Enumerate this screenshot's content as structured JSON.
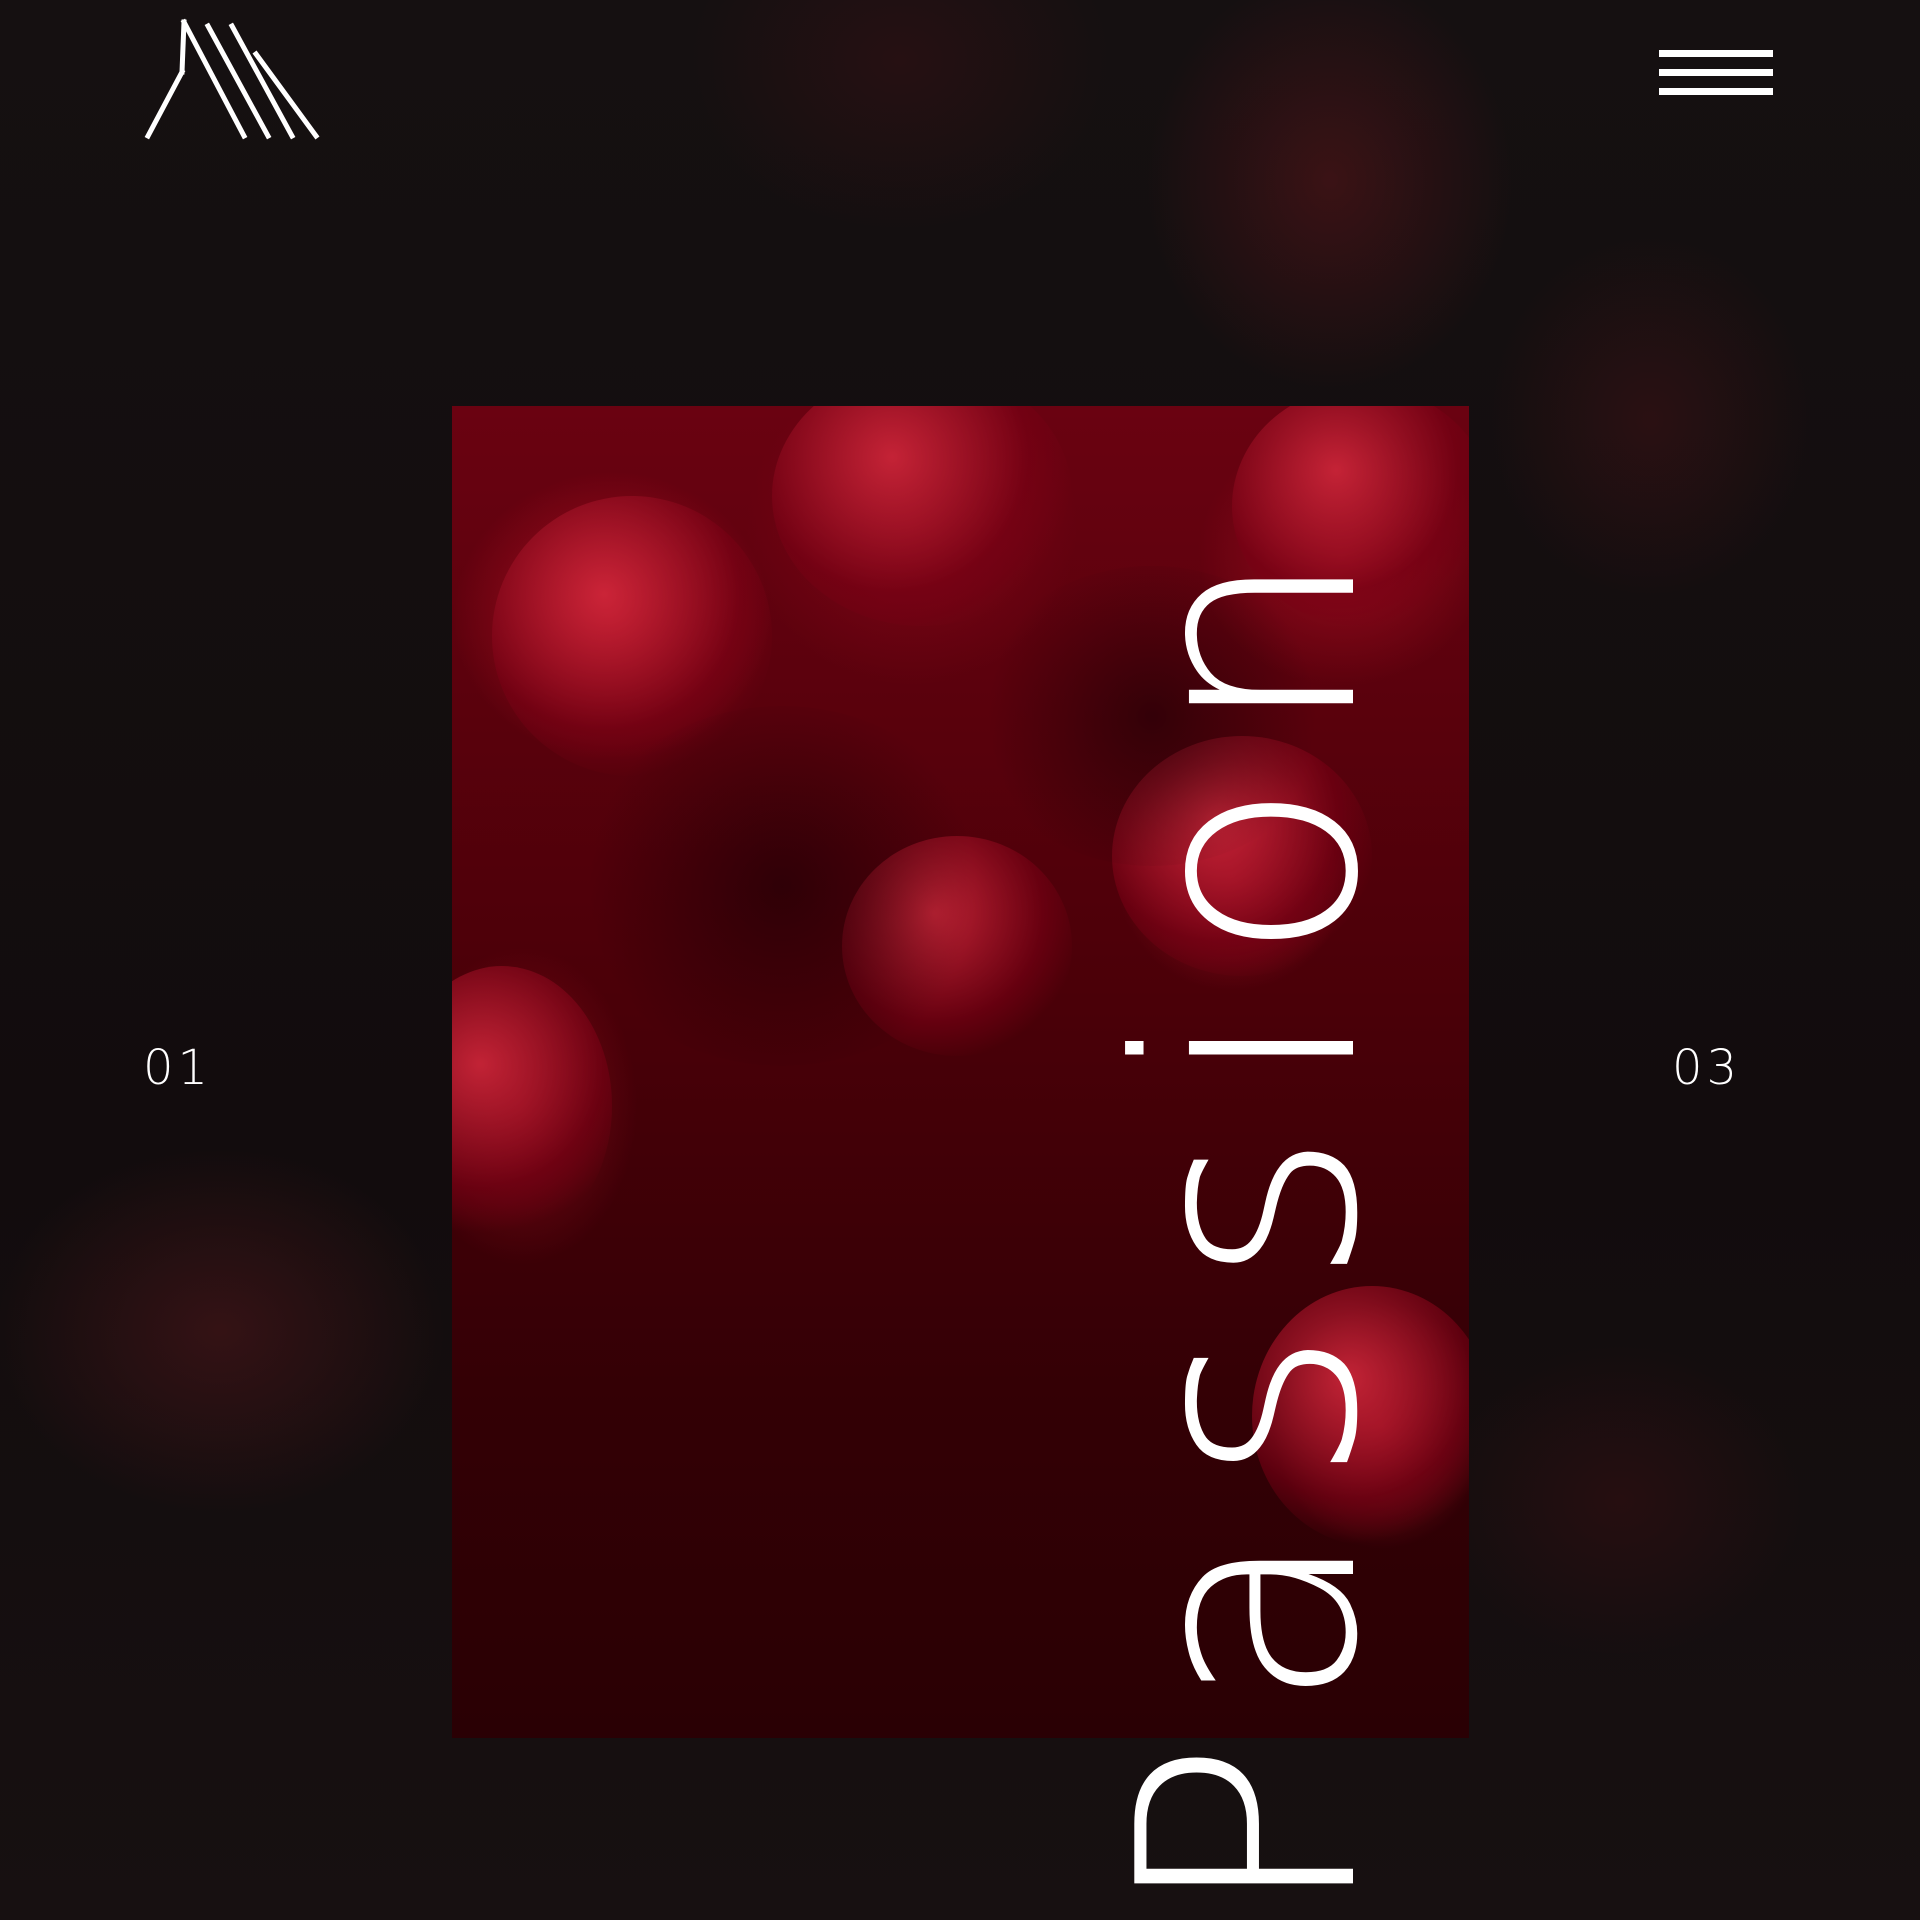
{
  "header": {
    "logo_icon": "triangle-lines-logo",
    "menu_icon": "hamburger-icon"
  },
  "hero": {
    "title": "Passion",
    "counter_current": "01",
    "counter_total": "03"
  },
  "colors": {
    "background": "#120d0e",
    "accent": "#6a0211",
    "text": "#ffffff"
  }
}
